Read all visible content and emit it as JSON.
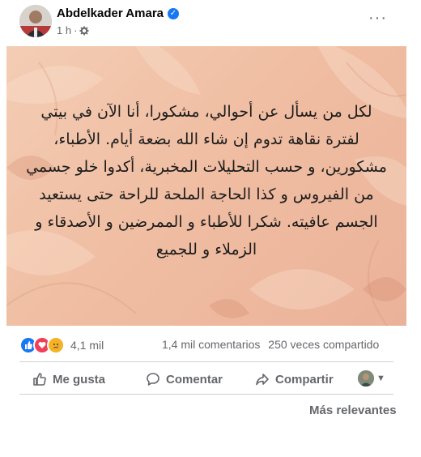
{
  "post": {
    "author": "Abdelkader Amara",
    "time": "1 h",
    "separator": "·",
    "more_label": "···",
    "text": "لكل من يسأل عن أحوالي، مشكورا، أنا الآن في بيتي لفترة نقاهة تدوم إن شاء الله بضعة أيام. الأطباء، مشكورين، و حسب التحليلات المخبرية، أكدوا خلو جسمي من الفيروس و كذا الحاجة الملحة للراحة حتى يستعيد الجسم عافيته. شكرا للأطباء و الممرضين و الأصدقاء و الزملاء و للجميع",
    "background_colors": [
      "#f3cdb4",
      "#eab299"
    ]
  },
  "stats": {
    "reaction_icons": [
      "like-icon",
      "love-icon",
      "sad-icon"
    ],
    "reactions_count": "4,1 mil",
    "comments": "1,4 mil comentarios",
    "shares": "250 veces compartido"
  },
  "actions": {
    "like": "Me gusta",
    "comment": "Comentar",
    "share": "Compartir"
  },
  "sort_label": "Más relevantes",
  "colors": {
    "secondary_text": "#65676b",
    "verified": "#1877f2",
    "divider": "#ced0d4"
  }
}
